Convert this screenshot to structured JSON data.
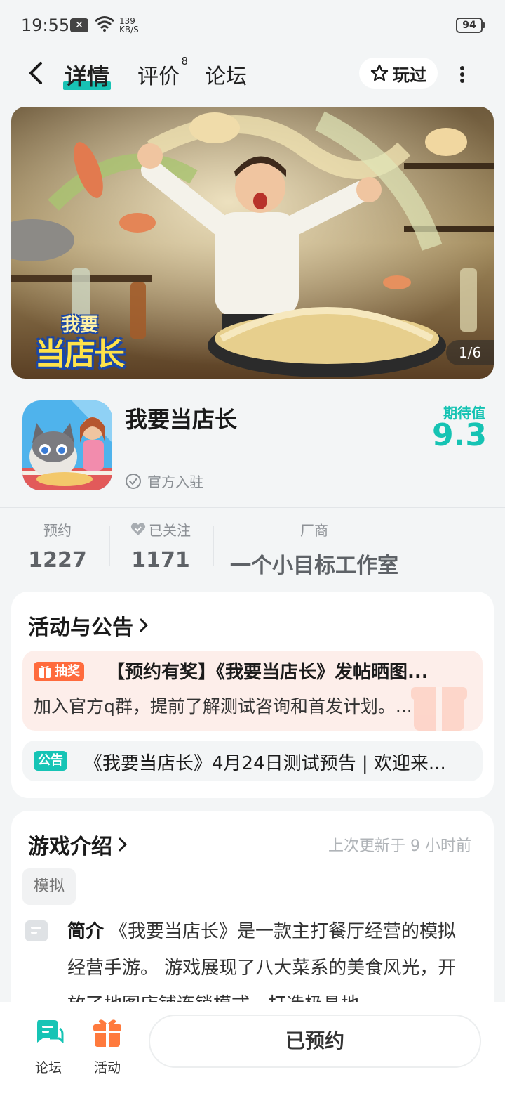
{
  "status_bar": {
    "time": "19:55",
    "speed_value": "139",
    "speed_unit": "KB/S",
    "battery": "94"
  },
  "nav": {
    "tabs": [
      "详情",
      "评价",
      "论坛"
    ],
    "review_count": "8",
    "played_label": "玩过"
  },
  "banner": {
    "logo_line1": "我要",
    "logo_line2": "当店长",
    "counter": "1/6"
  },
  "game": {
    "title": "我要当店长",
    "official_label": "官方入驻",
    "expect_label": "期待值",
    "expect_score": "9.3"
  },
  "stats": [
    {
      "label": "预约",
      "value": "1227"
    },
    {
      "label": "已关注",
      "value": "1171"
    },
    {
      "label": "厂商",
      "value": "一个小目标工作室"
    }
  ],
  "activities": {
    "title": "活动与公告",
    "lottery_tag": "抽奖",
    "lottery_title": "【预约有奖】《我要当店长》发帖晒图...",
    "lottery_desc": "加入官方q群，提前了解测试咨询和首发计划。...",
    "notice_tag": "公告",
    "notice_text": "《我要当店长》4月24日测试预告 | 欢迎来..."
  },
  "intro": {
    "title": "游戏介绍",
    "updated": "上次更新于 9 小时前",
    "genre": "模拟",
    "summary_label": "简介",
    "summary_text": "《我要当店长》是一款主打餐厅经营的模拟经营手游。 游戏展现了八大菜系的美食风光，开放了地图店铺连锁模式，打造极具地"
  },
  "bottom_bar": {
    "forum_label": "论坛",
    "activity_label": "活动",
    "reserved_label": "已预约"
  },
  "colors": {
    "accent": "#16c4b5",
    "lottery": "#ff6b3d",
    "activity_icon": "#ff7a3d"
  }
}
